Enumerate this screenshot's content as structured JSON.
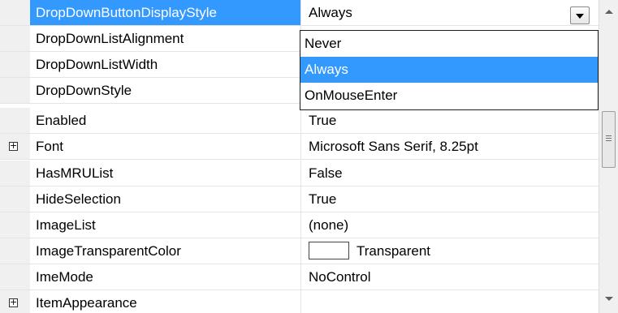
{
  "properties": [
    {
      "name": "DropDownButtonDisplayStyle",
      "value": "Always",
      "expandable": false,
      "selected": true
    },
    {
      "name": "DropDownListAlignment",
      "value": "",
      "expandable": false
    },
    {
      "name": "DropDownListWidth",
      "value": "",
      "expandable": false
    },
    {
      "name": "DropDownStyle",
      "value": "",
      "expandable": false
    },
    {
      "name": "Enabled",
      "value": "True",
      "expandable": false
    },
    {
      "name": "Font",
      "value": "Microsoft Sans Serif, 8.25pt",
      "expandable": true
    },
    {
      "name": "HasMRUList",
      "value": "False",
      "expandable": false
    },
    {
      "name": "HideSelection",
      "value": "True",
      "expandable": false
    },
    {
      "name": "ImageList",
      "value": "(none)",
      "expandable": false
    },
    {
      "name": "ImageTransparentColor",
      "value": "Transparent",
      "expandable": false,
      "swatch": "#ffffff"
    },
    {
      "name": "ImeMode",
      "value": "NoControl",
      "expandable": false
    },
    {
      "name": "ItemAppearance",
      "value": "",
      "expandable": true
    }
  ],
  "dropdown": {
    "options": [
      "Never",
      "Always",
      "OnMouseEnter"
    ],
    "highlighted": "Always"
  },
  "expander_glyph": "+",
  "colors": {
    "selection": "#3399ff",
    "gutter": "#f0f0f0",
    "grid_line": "#e4e4e4"
  },
  "icons": {
    "dropdown_button": "chevron-down-icon",
    "expander": "plus-box-icon",
    "scroll_up": "arrow-up-icon",
    "scroll_down": "arrow-down-icon"
  }
}
